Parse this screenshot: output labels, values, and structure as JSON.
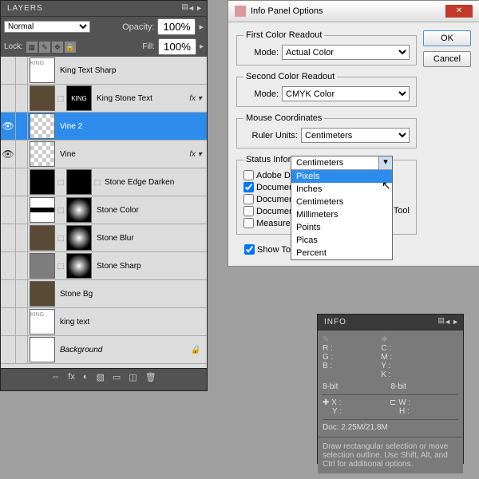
{
  "layers_panel": {
    "title": "LAYERS",
    "blend_mode": "Normal",
    "opacity_label": "Opacity:",
    "opacity_value": "100%",
    "lock_label": "Lock:",
    "fill_label": "Fill:",
    "fill_value": "100%",
    "layers": [
      {
        "eye": "",
        "name": "King Text Sharp",
        "fx": "",
        "thumbs": [
          "kingt2"
        ],
        "sel": false,
        "italic": false
      },
      {
        "eye": "",
        "name": "King Stone Text",
        "fx": "fx ▾",
        "thumbs": [
          "texture",
          "kingt"
        ],
        "sel": false,
        "italic": false
      },
      {
        "eye": "👁",
        "name": "Vine 2",
        "fx": "",
        "thumbs": [
          "checker"
        ],
        "sel": true,
        "italic": false
      },
      {
        "eye": "👁",
        "name": "Vine",
        "fx": "fx ▾",
        "thumbs": [
          "checker"
        ],
        "sel": false,
        "italic": false
      },
      {
        "eye": "",
        "name": "Stone Edge Darken",
        "fx": "",
        "thumbs": [
          "black",
          "black"
        ],
        "sel": false,
        "italic": false
      },
      {
        "eye": "",
        "name": "Stone Color",
        "fx": "",
        "thumbs": [
          "stripes",
          "radial"
        ],
        "sel": false,
        "italic": false
      },
      {
        "eye": "",
        "name": "Stone Blur",
        "fx": "",
        "thumbs": [
          "texture",
          "radial"
        ],
        "sel": false,
        "italic": false
      },
      {
        "eye": "",
        "name": "Stone Sharp",
        "fx": "",
        "thumbs": [
          "grey",
          "radial"
        ],
        "sel": false,
        "italic": false
      },
      {
        "eye": "",
        "name": "Stone Bg",
        "fx": "",
        "thumbs": [
          "texture"
        ],
        "sel": false,
        "italic": false
      },
      {
        "eye": "",
        "name": "king text",
        "fx": "",
        "thumbs": [
          "kingt2"
        ],
        "sel": false,
        "italic": false
      },
      {
        "eye": "",
        "name": "Background",
        "fx": "🔒",
        "thumbs": [
          "white"
        ],
        "sel": false,
        "italic": true
      }
    ],
    "foot_icons": [
      "⇔",
      "fx",
      "◐",
      "▧",
      "▭",
      "◫",
      "🗑"
    ]
  },
  "dialog": {
    "title": "Info Panel Options",
    "first_readout": {
      "legend": "First Color Readout",
      "mode_label": "Mode:",
      "mode_value": "Actual Color"
    },
    "second_readout": {
      "legend": "Second Color Readout",
      "mode_label": "Mode:",
      "mode_value": "CMYK Color"
    },
    "mouse": {
      "legend": "Mouse Coordinates",
      "ruler_label": "Ruler Units:",
      "ruler_value": "Centimeters",
      "options": [
        "Pixels",
        "Inches",
        "Centimeters",
        "Millimeters",
        "Points",
        "Picas",
        "Percent"
      ],
      "highlight": "Pixels"
    },
    "status": {
      "legend": "Status Infor",
      "items": [
        {
          "label": "Adobe Driv",
          "checked": false
        },
        {
          "label": "Document",
          "checked": true
        },
        {
          "label": "Document",
          "checked": false
        },
        {
          "label": "Document Dimensions",
          "checked": false
        },
        {
          "label": "Measurement Scale",
          "checked": false
        }
      ],
      "current_tool": "Current Tool"
    },
    "show_hints": "Show Tool Hints",
    "ok": "OK",
    "cancel": "Cancel"
  },
  "info": {
    "title": "INFO",
    "rgb": [
      "R :",
      "G :",
      "B :"
    ],
    "cmyk": [
      "C :",
      "M :",
      "Y :",
      "K :"
    ],
    "bit": "8-bit",
    "xy": [
      "X :",
      "Y :"
    ],
    "wh": [
      "W :",
      "H :"
    ],
    "doc": "Doc: 2.25M/21.8M",
    "hint": "Draw rectangular selection or move selection outline. Use Shift, Alt, and Ctrl for additional options."
  }
}
